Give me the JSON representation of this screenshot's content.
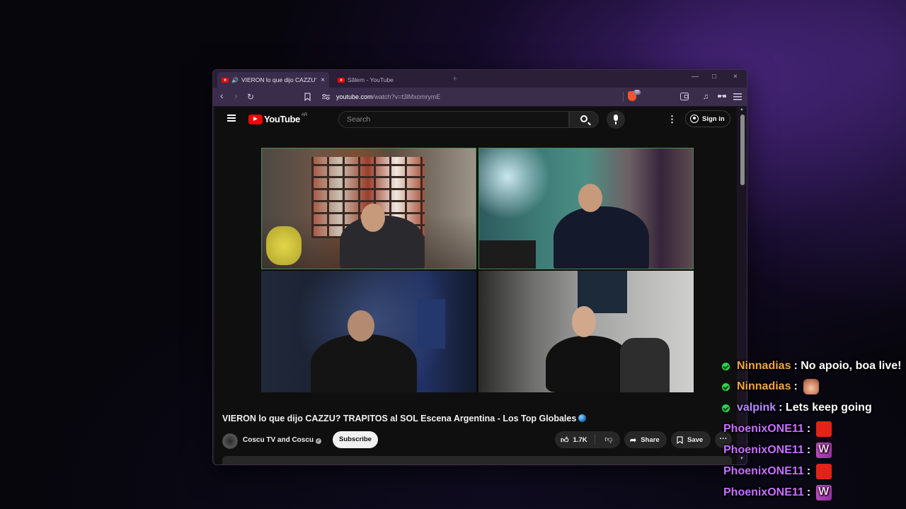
{
  "browser": {
    "tabs": [
      {
        "title": "VIERON lo que dijo CAZZU? TRAPITOS al SOL Escena Argentina",
        "active": true,
        "audio": true,
        "close": "×"
      },
      {
        "title": "Sãlem - YouTube",
        "active": false
      }
    ],
    "new_tab": "+",
    "window_controls": {
      "minimize": "—",
      "maximize": "□",
      "close": "×"
    },
    "nav": {
      "back": "‹",
      "forward": "›",
      "reload": "↻"
    },
    "url_host": "youtube.com",
    "url_path": "/watch?v=t3lMxomrymE",
    "icons": {
      "bookmark": "bookmark-icon",
      "site_info": "tune-icon",
      "shields": "brave-shields-icon",
      "wallet": "wallet-icon",
      "media": "music-icon",
      "vpn": "glasses-icon",
      "menu": "menu-icon"
    }
  },
  "youtube": {
    "logo_text": "YouTube",
    "country_code": "AR",
    "search_placeholder": "Search",
    "sign_in": "Sign in",
    "video_title": "VIERON lo que dijo CAZZU? TRAPITOS al SOL Escena Argentina - Los Top Globales",
    "channel_name": "Coscu TV and Coscu",
    "subscribe": "Subscribe",
    "likes": "1.7K",
    "share": "Share",
    "save": "Save",
    "more": "···"
  },
  "chat": {
    "messages": [
      {
        "user": "Ninnadias",
        "text": ": No apoio, boa live!",
        "color": "#f0a640",
        "verified": true
      },
      {
        "user": "Ninnadias",
        "text": ":",
        "color": "#f0a640",
        "verified": true,
        "emote": "cake"
      },
      {
        "user": "valpink",
        "text": ": Lets keep going",
        "color": "#b98aff",
        "verified": true
      },
      {
        "user": "PhoenixONE11",
        "text": ":",
        "color": "#c770ff",
        "verified": false,
        "emote": "red"
      },
      {
        "user": "PhoenixONE11",
        "text": ":",
        "color": "#c770ff",
        "verified": false,
        "emote": "w"
      },
      {
        "user": "PhoenixONE11",
        "text": ":",
        "color": "#c770ff",
        "verified": false,
        "emote": "red"
      },
      {
        "user": "PhoenixONE11",
        "text": ":",
        "color": "#c770ff",
        "verified": false,
        "emote": "w"
      }
    ]
  },
  "colors": {
    "accent": "#ff0000",
    "browser_frame": "#2a1f37",
    "chat_verified": "#2bd54b"
  }
}
